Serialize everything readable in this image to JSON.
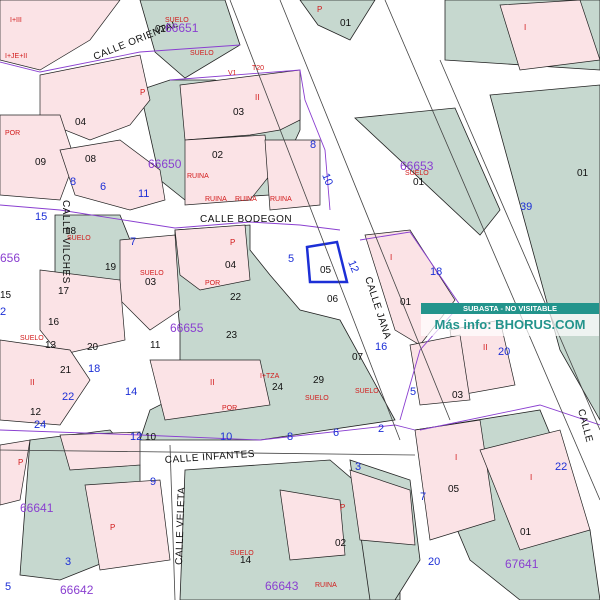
{
  "colors": {
    "green": "#c6d8cf",
    "pink": "#fbe3e6",
    "line": "#222222",
    "blockline": "#8a3fd0",
    "red": "#d21a1a",
    "blue": "#1c2fd6",
    "banner": "#23948c"
  },
  "streets": {
    "oriental": "CALLE ORIENTAL",
    "bodegon": "CALLE  BODEGON",
    "jana": "CALLE JANA",
    "infantes": "CALLE INFANTES",
    "veleta": "CALLE  VELETA",
    "vilches": "CALLE VILCHES",
    "right": "CALLE"
  },
  "blocks": {
    "b66651": "66651",
    "b66650": "66650",
    "b66653": "66653",
    "b66655": "66655",
    "b66656": "656",
    "b66641": "66641",
    "b66643": "66643",
    "b67641": "67641",
    "b66642": "66642"
  },
  "parcels": [
    "01",
    "02",
    "03",
    "04",
    "05",
    "06",
    "07",
    "08",
    "09",
    "10",
    "11",
    "12",
    "13",
    "14",
    "15",
    "16",
    "17",
    "18",
    "19",
    "20",
    "21",
    "22",
    "23",
    "24",
    "29",
    "02",
    "01",
    "01",
    "01",
    "03",
    "04",
    "05",
    "01",
    "02",
    "03"
  ],
  "marks": {
    "suelo": "SUELO",
    "ruina": "RUINA",
    "por": "POR",
    "p": "P",
    "i": "I",
    "ii": "II",
    "itza": "I+TZA",
    "ijeii": "I+JE+II",
    "iii": "I+III",
    "vt": "V1",
    "vt2": "T20"
  },
  "banner": {
    "top": "SUBASTA - NO VISITABLE",
    "bottom": "Más info: BHORUS.COM"
  }
}
